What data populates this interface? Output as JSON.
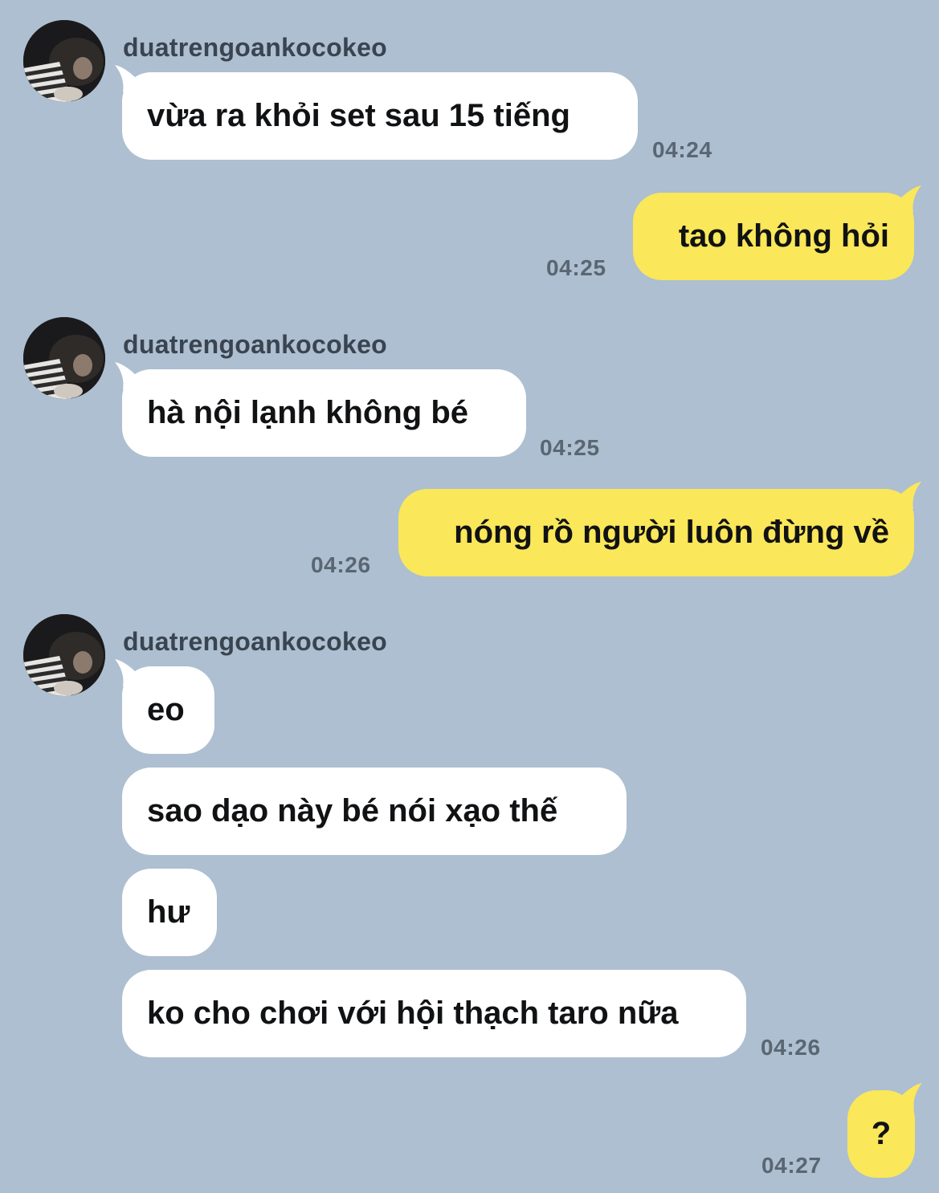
{
  "colors": {
    "background": "#adbfd0",
    "incoming_bubble": "#ffffff",
    "outgoing_bubble": "#fae75a",
    "sender_text": "#3a4450",
    "timestamp_text": "#5a6672"
  },
  "contact": {
    "name": "duatrengoankocokeo",
    "avatar_icon": "profile-photo-avatar"
  },
  "messages": [
    {
      "direction": "in",
      "text": "vừa ra khỏi set sau 15 tiếng",
      "time": "04:24"
    },
    {
      "direction": "out",
      "text": "tao không hỏi",
      "time": "04:25"
    },
    {
      "direction": "in",
      "text": "hà nội lạnh không bé",
      "time": "04:25"
    },
    {
      "direction": "out",
      "text": "nóng rồ người luôn đừng về",
      "time": "04:26"
    },
    {
      "direction": "in",
      "text": "eo",
      "time": ""
    },
    {
      "direction": "in",
      "text": "sao dạo này bé nói xạo thế",
      "time": ""
    },
    {
      "direction": "in",
      "text": "hư",
      "time": ""
    },
    {
      "direction": "in",
      "text": "ko cho chơi với hội thạch taro nữa",
      "time": "04:26"
    },
    {
      "direction": "out",
      "text": "?",
      "time": "04:27"
    }
  ]
}
